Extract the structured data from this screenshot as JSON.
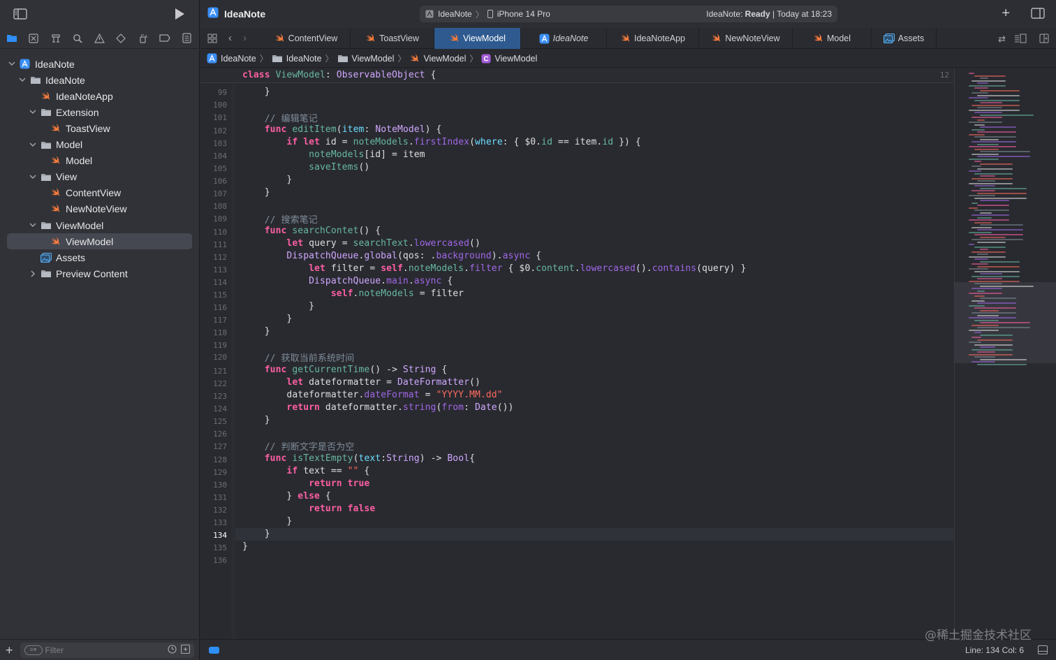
{
  "project": {
    "title": "IdeaNote"
  },
  "activity": {
    "scheme": "IdeaNote",
    "destination": "iPhone 14 Pro",
    "status_prefix": "IdeaNote: ",
    "status_state": "Ready",
    "status_time": " | Today at 18:23"
  },
  "navigator": {
    "items": [
      {
        "label": "IdeaNote",
        "kind": "project"
      },
      {
        "label": "IdeaNote",
        "kind": "folder"
      },
      {
        "label": "IdeaNoteApp",
        "kind": "swift"
      },
      {
        "label": "Extension",
        "kind": "folder"
      },
      {
        "label": "ToastView",
        "kind": "swift"
      },
      {
        "label": "Model",
        "kind": "folder"
      },
      {
        "label": "Model",
        "kind": "swift"
      },
      {
        "label": "View",
        "kind": "folder"
      },
      {
        "label": "ContentView",
        "kind": "swift"
      },
      {
        "label": "NewNoteView",
        "kind": "swift"
      },
      {
        "label": "ViewModel",
        "kind": "folder"
      },
      {
        "label": "ViewModel",
        "kind": "swift"
      },
      {
        "label": "Assets",
        "kind": "assets"
      },
      {
        "label": "Preview Content",
        "kind": "folder"
      }
    ],
    "filter_placeholder": "Filter"
  },
  "tabs": [
    {
      "label": "ContentView"
    },
    {
      "label": "ToastView"
    },
    {
      "label": "ViewModel"
    },
    {
      "label": "IdeaNote"
    },
    {
      "label": "IdeaNoteApp"
    },
    {
      "label": "NewNoteView"
    },
    {
      "label": "Model"
    },
    {
      "label": "Assets"
    }
  ],
  "breadcrumb": [
    "IdeaNote",
    "IdeaNote",
    "ViewModel",
    "ViewModel",
    "ViewModel"
  ],
  "editor": {
    "sticky_line_number": "12",
    "line_numbers": [
      "99",
      "100",
      "101",
      "102",
      "103",
      "104",
      "105",
      "106",
      "107",
      "108",
      "109",
      "110",
      "111",
      "112",
      "113",
      "114",
      "115",
      "116",
      "117",
      "118",
      "119",
      "120",
      "121",
      "122",
      "123",
      "124",
      "125",
      "126",
      "127",
      "128",
      "129",
      "130",
      "131",
      "132",
      "133",
      "134",
      "135",
      "136"
    ],
    "current_line": "134",
    "comments": {
      "edit": "// 编辑笔记",
      "search": "// 搜索笔记",
      "time": "// 获取当前系统时间",
      "empty": "// 判断文字是否为空"
    },
    "strings": {
      "date_format": "\"YYYY.MM.dd\"",
      "empty": "\"\""
    }
  },
  "statusbar": {
    "position": "Line: 134  Col: 6"
  },
  "watermark": "@稀土掘金技术社区",
  "colors": {
    "accent": "#2f8ff8",
    "keyword": "#fc5fa3",
    "selected_tab": "#2e5a8f"
  }
}
